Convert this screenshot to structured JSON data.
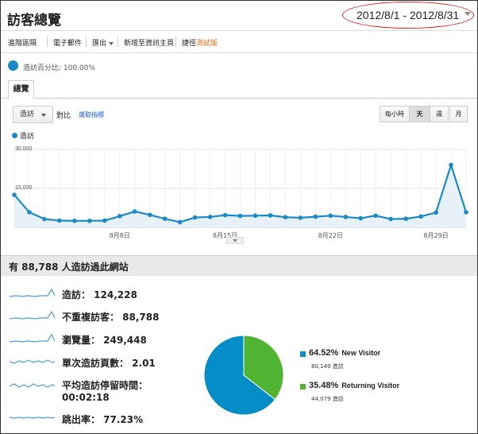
{
  "header": {
    "title": "訪客總覽",
    "date_range": "2012/8/1 - 2012/8/31"
  },
  "toolbar": {
    "advanced_segments": "進階區隔",
    "email": "電子郵件",
    "export": "匯出",
    "add_to_dashboard": "新增至資訊主頁",
    "shortcut": "捷徑",
    "beta": "測試版"
  },
  "segment": {
    "label": "造訪百分比: 100.00%"
  },
  "tabs": {
    "overview": "總覽"
  },
  "controls": {
    "metric": "造訪",
    "vs": "對比",
    "select_metric": "選取指標",
    "granularity": [
      "每小時",
      "天",
      "週",
      "月"
    ],
    "active_granularity": "天"
  },
  "chart_data": {
    "type": "line",
    "title": "",
    "series": [
      {
        "name": "造訪",
        "values": [
          12500,
          5800,
          3200,
          2600,
          2500,
          2500,
          2600,
          4300,
          6100,
          4800,
          3300,
          2000,
          3800,
          4000,
          4700,
          4400,
          4500,
          4600,
          3900,
          3700,
          4100,
          4500,
          4000,
          3500,
          4500,
          3200,
          3300,
          4200,
          5700,
          24000,
          5800
        ]
      }
    ],
    "x": [
      "8/1",
      "8/2",
      "8/3",
      "8/4",
      "8/5",
      "8/6",
      "8/7",
      "8/8",
      "8/9",
      "8/10",
      "8/11",
      "8/12",
      "8/13",
      "8/14",
      "8/15",
      "8/16",
      "8/17",
      "8/18",
      "8/19",
      "8/20",
      "8/21",
      "8/22",
      "8/23",
      "8/24",
      "8/25",
      "8/26",
      "8/27",
      "8/28",
      "8/29",
      "8/30",
      "8/31"
    ],
    "xticks": [
      "8月8日",
      "8月15日",
      "8月22日",
      "8月29日"
    ],
    "yticks": [
      "30,000",
      "15,000"
    ],
    "ylim": [
      0,
      30000
    ],
    "color": "#1a8ac6",
    "grid": true
  },
  "summary": {
    "headline": "有 88,788 人造訪過此網站",
    "metrics": [
      {
        "label": "造訪： 124,228"
      },
      {
        "label": "不重複訪客： 88,788"
      },
      {
        "label": "瀏覽量： 249,448"
      },
      {
        "label": "單次造訪頁數： 2.01"
      },
      {
        "label": "平均造訪停留時間：",
        "label2": "00:02:18"
      },
      {
        "label": "跳出率： 77.23%"
      }
    ]
  },
  "pie": {
    "slices": [
      {
        "pct": "64.52%",
        "name": "New Visitor",
        "count": "80,149 造訪",
        "value": 64.52,
        "color": "#058dc7"
      },
      {
        "pct": "35.48%",
        "name": "Returning Visitor",
        "count": "44,079 造訪",
        "value": 35.48,
        "color": "#50b432"
      }
    ]
  }
}
